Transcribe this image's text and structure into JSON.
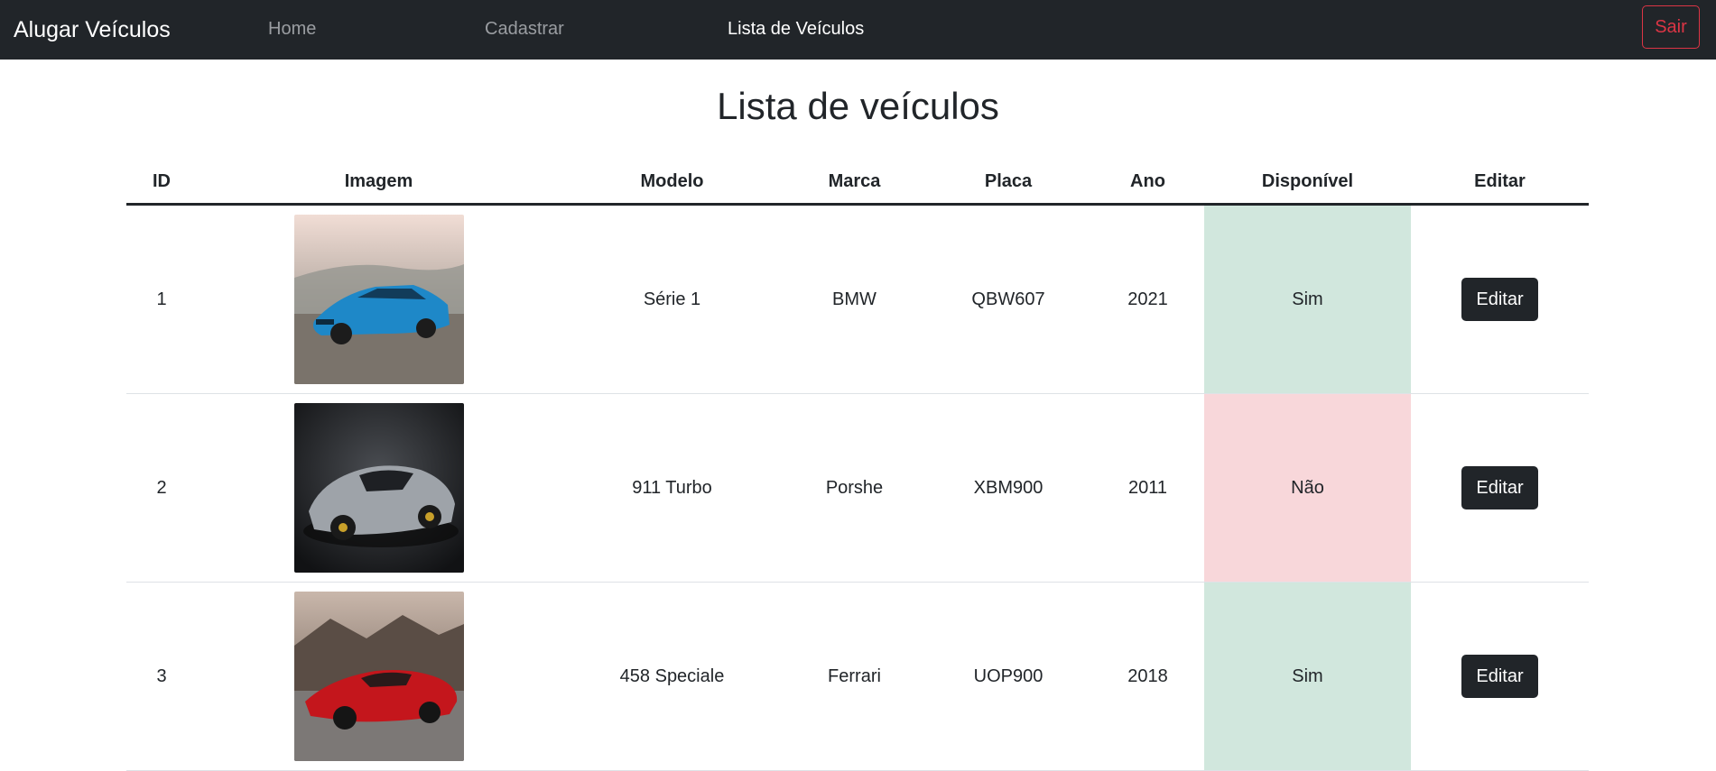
{
  "nav": {
    "brand": "Alugar Veículos",
    "links": [
      {
        "label": "Home"
      },
      {
        "label": "Cadastrar"
      },
      {
        "label": "Lista de Veículos"
      }
    ],
    "logout_label": "Sair"
  },
  "main": {
    "title": "Lista de veículos",
    "columns": [
      "ID",
      "Imagem",
      "Modelo",
      "Marca",
      "Placa",
      "Ano",
      "Disponível",
      "Editar"
    ],
    "rows": [
      {
        "id": "1",
        "image": "car-photo-blue-sedan",
        "model": "Série 1",
        "brand": "BMW",
        "plate": "QBW607",
        "year": "2021",
        "available": "Sim",
        "edit_label": "Editar"
      },
      {
        "id": "2",
        "image": "car-photo-silver-sports",
        "model": "911 Turbo",
        "brand": "Porshe",
        "plate": "XBM900",
        "year": "2011",
        "available": "Não",
        "edit_label": "Editar"
      },
      {
        "id": "3",
        "image": "car-photo-red-sports",
        "model": "458 Speciale",
        "brand": "Ferrari",
        "plate": "UOP900",
        "year": "2018",
        "available": "Sim",
        "edit_label": "Editar"
      }
    ]
  },
  "colors": {
    "navbar": "#212529",
    "available_yes": "#d1e7dd",
    "available_no": "#f8d7da",
    "logout": "#dc3545"
  }
}
